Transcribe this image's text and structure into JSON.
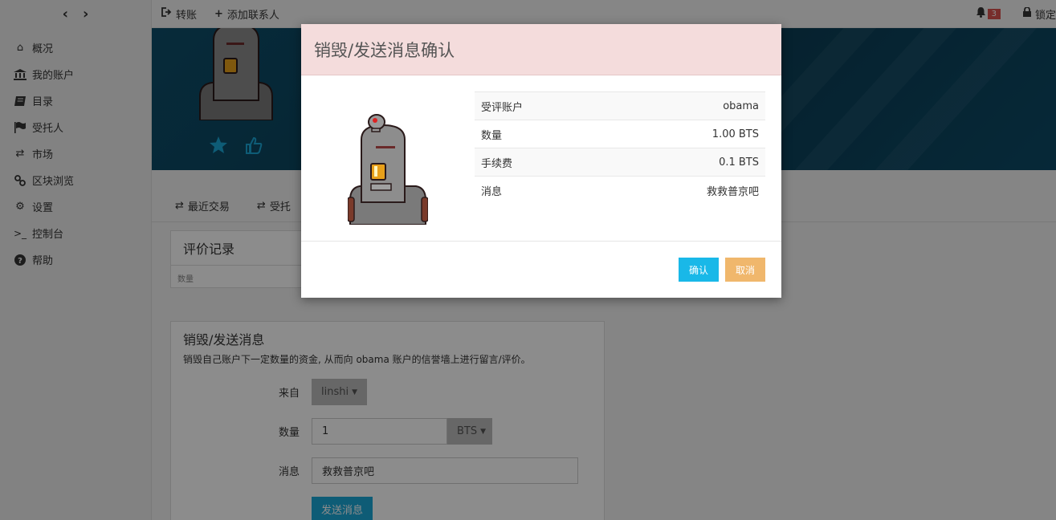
{
  "nav": {
    "back_arrow": "‹",
    "forward_arrow": "›",
    "items": [
      {
        "icon": "home-icon",
        "label": "概况"
      },
      {
        "icon": "bank-icon",
        "label": "我的账户"
      },
      {
        "icon": "book-icon",
        "label": "目录"
      },
      {
        "icon": "flag-icon",
        "label": "受托人"
      },
      {
        "icon": "exchange-icon",
        "label": "市场"
      },
      {
        "icon": "chain-icon",
        "label": "区块浏览"
      },
      {
        "icon": "gears-icon",
        "label": "设置"
      },
      {
        "icon": "terminal-icon",
        "label": "控制台"
      },
      {
        "icon": "help-icon",
        "label": "帮助"
      }
    ]
  },
  "topbar": {
    "transfer_label": "转账",
    "add_contact_label": "添加联系人",
    "notification_count": "3",
    "lock_label": "锁定"
  },
  "tabs": {
    "recent_tx": "最近交易",
    "delegate": "受托"
  },
  "review": {
    "title": "评价记录",
    "col_amount": "数量"
  },
  "burn": {
    "title": "销毁/发送消息",
    "description": "销毁自己账户下一定数量的资金, 从而向 obama 账户的信誉墙上进行留言/评价。",
    "from_label": "来自",
    "from_value": "linshi",
    "amount_label": "数量",
    "amount_value": "1",
    "asset": "BTS",
    "message_label": "消息",
    "message_value": "救救普京吧",
    "send_button": "发送消息"
  },
  "modal": {
    "title": "销毁/发送消息确认",
    "rows": [
      {
        "label": "受评账户",
        "value": "obama"
      },
      {
        "label": "数量",
        "value": "1.00 BTS"
      },
      {
        "label": "手续费",
        "value": "0.1 BTS"
      },
      {
        "label": "消息",
        "value": "救救普京吧"
      }
    ],
    "confirm": "确认",
    "cancel": "取消"
  },
  "colors": {
    "banner": "#0d4e6a",
    "modal_header": "#f4dcdc",
    "confirm": "#19b8e8",
    "cancel": "#f0b76c",
    "send": "#1ba8d8"
  }
}
